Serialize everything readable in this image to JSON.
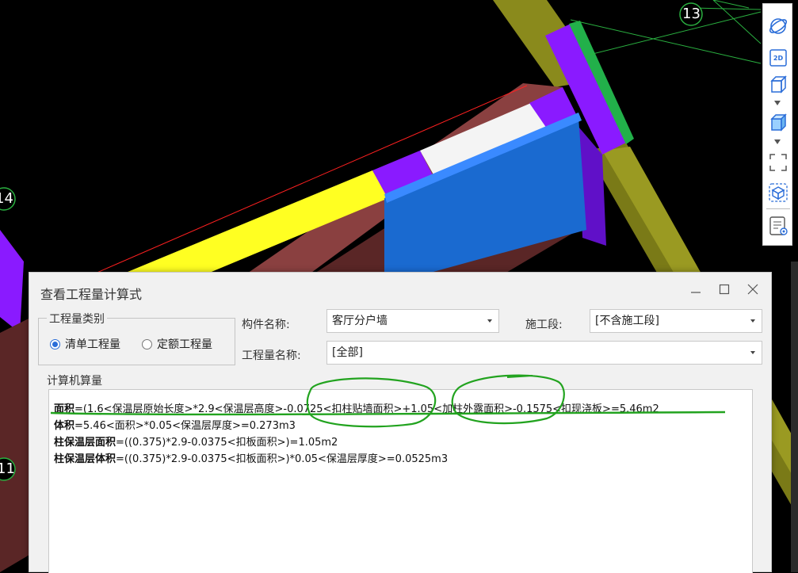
{
  "scene": {
    "axis_labels": [
      "13",
      "14",
      "11"
    ]
  },
  "toolbar": {
    "items": [
      "orbit-icon",
      "2d-view-icon",
      "3d-box-icon",
      "3d-box-solid-icon",
      "fullscreen-icon",
      "view-cube-icon",
      "report-view-icon"
    ],
    "label_2d": "2D"
  },
  "dialog": {
    "title": "查看工程量计算式",
    "category_group": {
      "legend": "工程量类别",
      "options": [
        "清单工程量",
        "定额工程量"
      ],
      "selected": "清单工程量"
    },
    "component_label": "构件名称:",
    "component_value": "客厅分户墙",
    "stage_label": "施工段:",
    "stage_value": "[不含施工段]",
    "quantity_label": "工程量名称:",
    "quantity_value": "[全部]",
    "calc_legend": "计算机算量",
    "lines": [
      {
        "name": "面积",
        "formula": "=(1.6<保温层原始长度>*2.9<保温层高度>-0.0725<扣柱贴墙面积>+1.05<加柱外露面积>-0.1575<扣现浇板>=5.46m2"
      },
      {
        "name": "体积",
        "formula": "=5.46<面积>*0.05<保温层厚度>=0.273m3"
      },
      {
        "name": "柱保温层面积",
        "formula": "=((0.375)*2.9-0.0375<扣板面积>)=1.05m2"
      },
      {
        "name": "柱保温层体积",
        "formula": "=((0.375)*2.9-0.0375<扣板面积>)*0.05<保温层厚度>=0.0525m3"
      }
    ]
  },
  "colors": {
    "accent": "#2a6dd8",
    "annotation": "#22a31f"
  }
}
